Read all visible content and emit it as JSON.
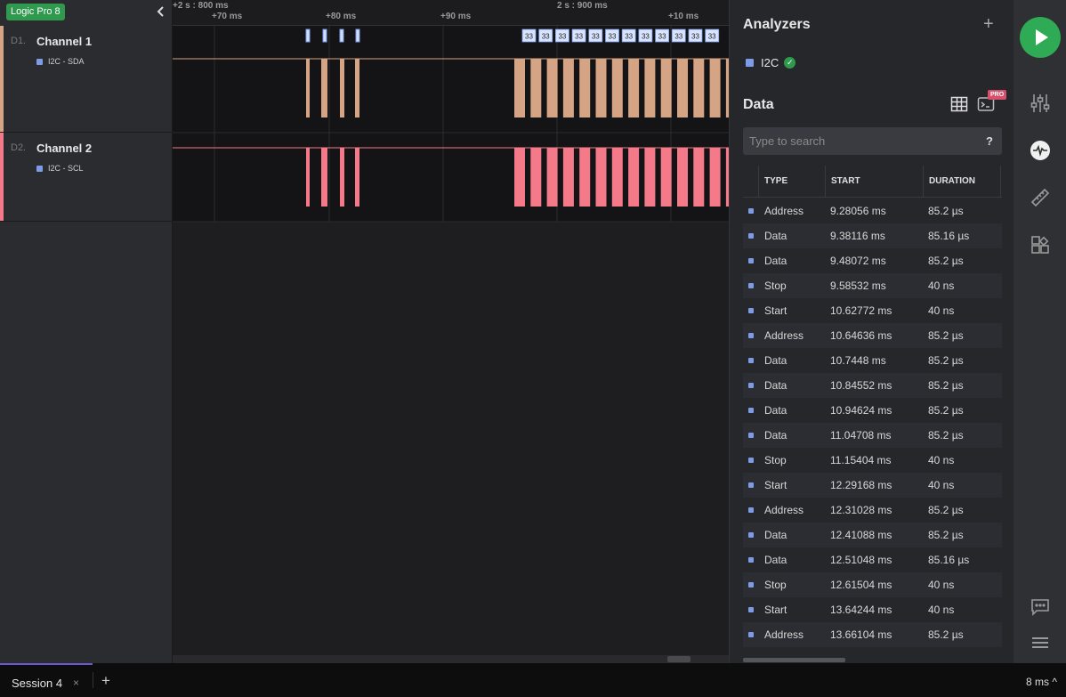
{
  "device_badge": "Logic Pro 8",
  "channels": [
    {
      "index": "D1.",
      "name": "Channel 1",
      "analyzer": "I2C - SDA",
      "color": "#d4a484"
    },
    {
      "index": "D2.",
      "name": "Channel 2",
      "analyzer": "I2C - SCL",
      "color": "#f47a8a"
    }
  ],
  "ruler": {
    "major": [
      {
        "label": "+2 s : 800 ms"
      },
      {
        "label": "2 s : 900 ms"
      }
    ],
    "minor": [
      "+70 ms",
      "+80 ms",
      "+90 ms",
      "+10 ms"
    ]
  },
  "protocol_bubbles": [
    "33",
    "33",
    "33",
    "33",
    "33",
    "33",
    "33",
    "33",
    "33",
    "33",
    "33",
    "33"
  ],
  "panel": {
    "analyzers_title": "Analyzers",
    "add_symbol": "+",
    "analyzer_name": "I2C",
    "data_title": "Data",
    "pro_label": "PRO",
    "search_placeholder": "Type to search",
    "search_help": "?",
    "columns": [
      "TYPE",
      "START",
      "DURATION"
    ],
    "rows": [
      {
        "type": "Address",
        "start": "9.28056 ms",
        "duration": "85.2 µs"
      },
      {
        "type": "Data",
        "start": "9.38116 ms",
        "duration": "85.16 µs"
      },
      {
        "type": "Data",
        "start": "9.48072 ms",
        "duration": "85.2 µs"
      },
      {
        "type": "Stop",
        "start": "9.58532 ms",
        "duration": "40 ns"
      },
      {
        "type": "Start",
        "start": "10.62772 ms",
        "duration": "40 ns"
      },
      {
        "type": "Address",
        "start": "10.64636 ms",
        "duration": "85.2 µs"
      },
      {
        "type": "Data",
        "start": "10.7448 ms",
        "duration": "85.2 µs"
      },
      {
        "type": "Data",
        "start": "10.84552 ms",
        "duration": "85.2 µs"
      },
      {
        "type": "Data",
        "start": "10.94624 ms",
        "duration": "85.2 µs"
      },
      {
        "type": "Data",
        "start": "11.04708 ms",
        "duration": "85.2 µs"
      },
      {
        "type": "Stop",
        "start": "11.15404 ms",
        "duration": "40 ns"
      },
      {
        "type": "Start",
        "start": "12.29168 ms",
        "duration": "40 ns"
      },
      {
        "type": "Address",
        "start": "12.31028 ms",
        "duration": "85.2 µs"
      },
      {
        "type": "Data",
        "start": "12.41088 ms",
        "duration": "85.2 µs"
      },
      {
        "type": "Data",
        "start": "12.51048 ms",
        "duration": "85.16 µs"
      },
      {
        "type": "Stop",
        "start": "12.61504 ms",
        "duration": "40 ns"
      },
      {
        "type": "Start",
        "start": "13.64244 ms",
        "duration": "40 ns"
      },
      {
        "type": "Address",
        "start": "13.66104 ms",
        "duration": "85.2 µs"
      }
    ]
  },
  "rail_icons": [
    "play-icon",
    "sliders-icon",
    "waveform-icon",
    "ruler-icon",
    "extensions-icon",
    "chat-icon",
    "menu-icon"
  ],
  "bottom": {
    "session_label": "Session 4",
    "close_symbol": "×",
    "new_tab_symbol": "+",
    "zoom": "8 ms ^"
  }
}
